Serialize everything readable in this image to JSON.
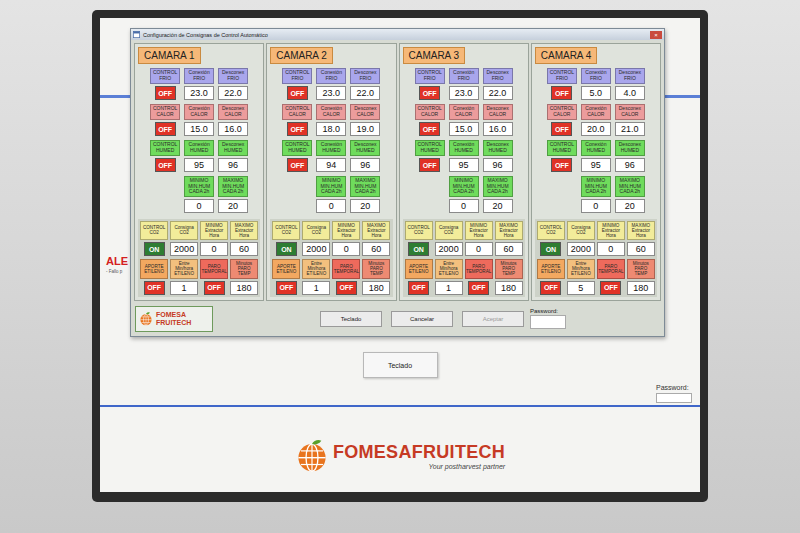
{
  "window": {
    "title": "Configuración de Consignas de Control Automático",
    "close": "×"
  },
  "cameras": [
    {
      "name": "CAMARA 1",
      "rows": [
        {
          "kind": "control",
          "cells": [
            {
              "label": "CONTROL FRIO",
              "color": "#a9a6ec",
              "kind": "toggle",
              "text": "OFF",
              "on": false
            },
            {
              "label": "Conexión FRIO",
              "color": "#a9a6ec",
              "kind": "value",
              "text": "23.0"
            },
            {
              "label": "Desconex FRIO",
              "color": "#a9a6ec",
              "kind": "value",
              "text": "22.0"
            }
          ]
        },
        {
          "kind": "control",
          "cells": [
            {
              "label": "CONTROL CALOR",
              "color": "#ec9c9c",
              "kind": "toggle",
              "text": "OFF",
              "on": false
            },
            {
              "label": "Conexión CALOR",
              "color": "#ec9c9c",
              "kind": "value",
              "text": "15.0"
            },
            {
              "label": "Desconex CALOR",
              "color": "#ec9c9c",
              "kind": "value",
              "text": "16.0"
            }
          ]
        },
        {
          "kind": "control",
          "cells": [
            {
              "label": "CONTROL HUMED",
              "color": "#6fdc5c",
              "kind": "toggle",
              "text": "OFF",
              "on": false
            },
            {
              "label": "Conexión HUMED",
              "color": "#6fdc5c",
              "kind": "value",
              "text": "95"
            },
            {
              "label": "Desconex HUMED",
              "color": "#6fdc5c",
              "kind": "value",
              "text": "96"
            }
          ]
        },
        {
          "kind": "range",
          "cells": [
            {
              "label": "MINIMO MIN.HUM CADA 2h",
              "color": "#6fdc5c",
              "kind": "value",
              "text": "0"
            },
            {
              "label": "MAXIMO MIN.HUM CADA 2h",
              "color": "#6fdc5c",
              "kind": "value",
              "text": "20"
            }
          ]
        },
        {
          "kind": "bottom",
          "cells": [
            {
              "label": "CONTROL CO2",
              "color": "#f2ec9a",
              "kind": "toggle",
              "text": "ON",
              "on": true
            },
            {
              "label": "Consigna CO2",
              "color": "#f2ec9a",
              "kind": "value",
              "text": "2000"
            },
            {
              "label": "MINIMO Extractor Hora",
              "color": "#f2ec9a",
              "kind": "value",
              "text": "0"
            },
            {
              "label": "MAXIMO Extractor Hora",
              "color": "#f2ec9a",
              "kind": "value",
              "text": "60"
            }
          ]
        },
        {
          "kind": "bottom",
          "cells": [
            {
              "label": "APORTE ETILENO",
              "color": "#f3a860",
              "kind": "toggle",
              "text": "OFF",
              "on": false
            },
            {
              "label": "Entre Min/hora ETILENO",
              "color": "#f3c07e",
              "kind": "value",
              "text": "1"
            },
            {
              "label": "PARO TEMPORAL",
              "color": "#ee6a5c",
              "kind": "toggle",
              "text": "OFF",
              "on": false
            },
            {
              "label": "Minutos PARO TEMP",
              "color": "#ee8a72",
              "kind": "value",
              "text": "180"
            }
          ]
        }
      ]
    },
    {
      "name": "CAMARA 2",
      "rows": [
        {
          "kind": "control",
          "cells": [
            {
              "label": "CONTROL FRIO",
              "color": "#a9a6ec",
              "kind": "toggle",
              "text": "OFF",
              "on": false
            },
            {
              "label": "Conexión FRIO",
              "color": "#a9a6ec",
              "kind": "value",
              "text": "23.0"
            },
            {
              "label": "Desconex FRIO",
              "color": "#a9a6ec",
              "kind": "value",
              "text": "22.0"
            }
          ]
        },
        {
          "kind": "control",
          "cells": [
            {
              "label": "CONTROL CALOR",
              "color": "#ec9c9c",
              "kind": "toggle",
              "text": "OFF",
              "on": false
            },
            {
              "label": "Conexión CALOR",
              "color": "#ec9c9c",
              "kind": "value",
              "text": "18.0"
            },
            {
              "label": "Desconex CALOR",
              "color": "#ec9c9c",
              "kind": "value",
              "text": "19.0"
            }
          ]
        },
        {
          "kind": "control",
          "cells": [
            {
              "label": "CONTROL HUMED",
              "color": "#6fdc5c",
              "kind": "toggle",
              "text": "OFF",
              "on": false
            },
            {
              "label": "Conexión HUMED",
              "color": "#6fdc5c",
              "kind": "value",
              "text": "94"
            },
            {
              "label": "Desconex HUMED",
              "color": "#6fdc5c",
              "kind": "value",
              "text": "96"
            }
          ]
        },
        {
          "kind": "range",
          "cells": [
            {
              "label": "MINIMO MIN.HUM CADA 2h",
              "color": "#6fdc5c",
              "kind": "value",
              "text": "0"
            },
            {
              "label": "MAXIMO MIN.HUM CADA 2h",
              "color": "#6fdc5c",
              "kind": "value",
              "text": "20"
            }
          ]
        },
        {
          "kind": "bottom",
          "cells": [
            {
              "label": "CONTROL CO2",
              "color": "#f2ec9a",
              "kind": "toggle",
              "text": "ON",
              "on": true
            },
            {
              "label": "Consigna CO2",
              "color": "#f2ec9a",
              "kind": "value",
              "text": "2000"
            },
            {
              "label": "MINIMO Extractor Hora",
              "color": "#f2ec9a",
              "kind": "value",
              "text": "0"
            },
            {
              "label": "MAXIMO Extractor Hora",
              "color": "#f2ec9a",
              "kind": "value",
              "text": "60"
            }
          ]
        },
        {
          "kind": "bottom",
          "cells": [
            {
              "label": "APORTE ETILENO",
              "color": "#f3a860",
              "kind": "toggle",
              "text": "OFF",
              "on": false
            },
            {
              "label": "Entre Min/hora ETILENO",
              "color": "#f3c07e",
              "kind": "value",
              "text": "1"
            },
            {
              "label": "PARO TEMPORAL",
              "color": "#ee6a5c",
              "kind": "toggle",
              "text": "OFF",
              "on": false
            },
            {
              "label": "Minutos PARO TEMP",
              "color": "#ee8a72",
              "kind": "value",
              "text": "180"
            }
          ]
        }
      ]
    },
    {
      "name": "CAMARA 3",
      "rows": [
        {
          "kind": "control",
          "cells": [
            {
              "label": "CONTROL FRIO",
              "color": "#a9a6ec",
              "kind": "toggle",
              "text": "OFF",
              "on": false
            },
            {
              "label": "Conexión FRIO",
              "color": "#a9a6ec",
              "kind": "value",
              "text": "23.0"
            },
            {
              "label": "Desconex FRIO",
              "color": "#a9a6ec",
              "kind": "value",
              "text": "22.0"
            }
          ]
        },
        {
          "kind": "control",
          "cells": [
            {
              "label": "CONTROL CALOR",
              "color": "#ec9c9c",
              "kind": "toggle",
              "text": "OFF",
              "on": false
            },
            {
              "label": "Conexión CALOR",
              "color": "#ec9c9c",
              "kind": "value",
              "text": "15.0"
            },
            {
              "label": "Desconex CALOR",
              "color": "#ec9c9c",
              "kind": "value",
              "text": "16.0"
            }
          ]
        },
        {
          "kind": "control",
          "cells": [
            {
              "label": "CONTROL HUMED",
              "color": "#6fdc5c",
              "kind": "toggle",
              "text": "OFF",
              "on": false
            },
            {
              "label": "Conexión HUMED",
              "color": "#6fdc5c",
              "kind": "value",
              "text": "95"
            },
            {
              "label": "Desconex HUMED",
              "color": "#6fdc5c",
              "kind": "value",
              "text": "96"
            }
          ]
        },
        {
          "kind": "range",
          "cells": [
            {
              "label": "MINIMO MIN.HUM CADA 2h",
              "color": "#6fdc5c",
              "kind": "value",
              "text": "0"
            },
            {
              "label": "MAXIMO MIN.HUM CADA 2h",
              "color": "#6fdc5c",
              "kind": "value",
              "text": "20"
            }
          ]
        },
        {
          "kind": "bottom",
          "cells": [
            {
              "label": "CONTROL CO2",
              "color": "#f2ec9a",
              "kind": "toggle",
              "text": "ON",
              "on": true
            },
            {
              "label": "Consigna CO2",
              "color": "#f2ec9a",
              "kind": "value",
              "text": "2000"
            },
            {
              "label": "MINIMO Extractor Hora",
              "color": "#f2ec9a",
              "kind": "value",
              "text": "0"
            },
            {
              "label": "MAXIMO Extractor Hora",
              "color": "#f2ec9a",
              "kind": "value",
              "text": "60"
            }
          ]
        },
        {
          "kind": "bottom",
          "cells": [
            {
              "label": "APORTE ETILENO",
              "color": "#f3a860",
              "kind": "toggle",
              "text": "OFF",
              "on": false
            },
            {
              "label": "Entre Min/hora ETILENO",
              "color": "#f3c07e",
              "kind": "value",
              "text": "1"
            },
            {
              "label": "PARO TEMPORAL",
              "color": "#ee6a5c",
              "kind": "toggle",
              "text": "OFF",
              "on": false
            },
            {
              "label": "Minutos PARO TEMP",
              "color": "#ee8a72",
              "kind": "value",
              "text": "180"
            }
          ]
        }
      ]
    },
    {
      "name": "CAMARA 4",
      "rows": [
        {
          "kind": "control",
          "cells": [
            {
              "label": "CONTROL FRIO",
              "color": "#a9a6ec",
              "kind": "toggle",
              "text": "OFF",
              "on": false
            },
            {
              "label": "Conexión FRIO",
              "color": "#a9a6ec",
              "kind": "value",
              "text": "5.0"
            },
            {
              "label": "Desconex FRIO",
              "color": "#a9a6ec",
              "kind": "value",
              "text": "4.0"
            }
          ]
        },
        {
          "kind": "control",
          "cells": [
            {
              "label": "CONTROL CALOR",
              "color": "#ec9c9c",
              "kind": "toggle",
              "text": "OFF",
              "on": false
            },
            {
              "label": "Conexión CALOR",
              "color": "#ec9c9c",
              "kind": "value",
              "text": "20.0"
            },
            {
              "label": "Desconex CALOR",
              "color": "#ec9c9c",
              "kind": "value",
              "text": "21.0"
            }
          ]
        },
        {
          "kind": "control",
          "cells": [
            {
              "label": "CONTROL HUMED",
              "color": "#6fdc5c",
              "kind": "toggle",
              "text": "OFF",
              "on": false
            },
            {
              "label": "Conexión HUMED",
              "color": "#6fdc5c",
              "kind": "value",
              "text": "95"
            },
            {
              "label": "Desconex HUMED",
              "color": "#6fdc5c",
              "kind": "value",
              "text": "96"
            }
          ]
        },
        {
          "kind": "range",
          "cells": [
            {
              "label": "MINIMO MIN.HUM CADA 2h",
              "color": "#6fdc5c",
              "kind": "value",
              "text": "0"
            },
            {
              "label": "MAXIMO MIN.HUM CADA 2h",
              "color": "#6fdc5c",
              "kind": "value",
              "text": "20"
            }
          ]
        },
        {
          "kind": "bottom",
          "cells": [
            {
              "label": "CONTROL CO2",
              "color": "#f2ec9a",
              "kind": "toggle",
              "text": "ON",
              "on": true
            },
            {
              "label": "Consigna CO2",
              "color": "#f2ec9a",
              "kind": "value",
              "text": "2000"
            },
            {
              "label": "MINIMO Extractor Hora",
              "color": "#f2ec9a",
              "kind": "value",
              "text": "0"
            },
            {
              "label": "MAXIMO Extractor Hora",
              "color": "#f2ec9a",
              "kind": "value",
              "text": "60"
            }
          ]
        },
        {
          "kind": "bottom",
          "cells": [
            {
              "label": "APORTE ETILENO",
              "color": "#f3a860",
              "kind": "toggle",
              "text": "OFF",
              "on": false
            },
            {
              "label": "Entre Min/hora ETILENO",
              "color": "#f3c07e",
              "kind": "value",
              "text": "5"
            },
            {
              "label": "PARO TEMPORAL",
              "color": "#ee6a5c",
              "kind": "toggle",
              "text": "OFF",
              "on": false
            },
            {
              "label": "Minutos PARO TEMP",
              "color": "#ee8a72",
              "kind": "value",
              "text": "180"
            }
          ]
        }
      ]
    }
  ],
  "footer": {
    "logo": {
      "name": "FOMESA",
      "sub": "FRUITECH"
    },
    "buttons": [
      {
        "label": "Teclado",
        "disabled": false
      },
      {
        "label": "Cancelar",
        "disabled": false
      },
      {
        "label": "Aceptar",
        "disabled": true
      }
    ],
    "password": {
      "label": "Password:"
    }
  },
  "background": {
    "alarm": {
      "title": "ALE",
      "detail": "- Fallo p"
    },
    "keyboard_button": "Teclado",
    "password": {
      "label": "Password:"
    },
    "brand": {
      "name": "FOMESA",
      "sub": "FRUITECH",
      "tagline": "Your postharvest partner"
    }
  }
}
